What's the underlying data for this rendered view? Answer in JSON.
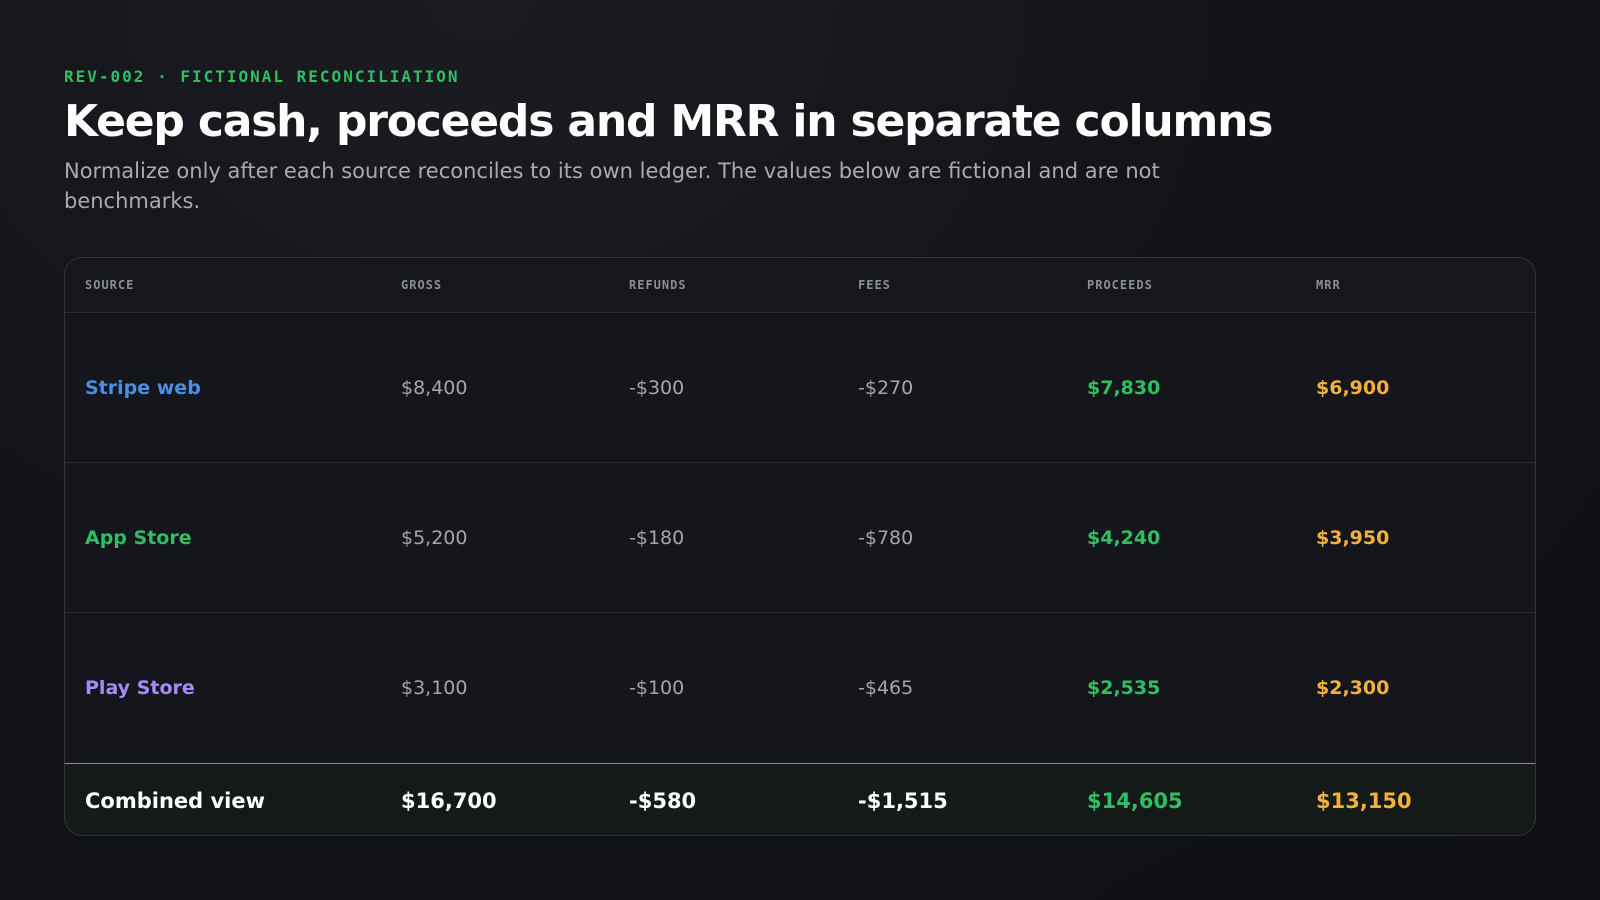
{
  "eyebrow": "REV-002 · FICTIONAL RECONCILIATION",
  "title": "Keep cash, proceeds and MRR in separate columns",
  "subtitle": "Normalize only after each source reconciles to its own ledger. The values below are fictional and are not benchmarks.",
  "colors": {
    "accent_green": "#2fbf63",
    "accent_amber": "#f2b13c",
    "stripe_blue": "#4a8fe6",
    "app_store_green": "#2fbf63",
    "play_store_purple": "#a78bfa"
  },
  "table": {
    "headers": [
      "SOURCE",
      "GROSS",
      "REFUNDS",
      "FEES",
      "PROCEEDS",
      "MRR"
    ],
    "rows": [
      {
        "source": "Stripe web",
        "source_color": "#4a8fe6",
        "gross": "$8,400",
        "refunds": "-$300",
        "fees": "-$270",
        "proceeds": "$7,830",
        "mrr": "$6,900"
      },
      {
        "source": "App Store",
        "source_color": "#2fbf63",
        "gross": "$5,200",
        "refunds": "-$180",
        "fees": "-$780",
        "proceeds": "$4,240",
        "mrr": "$3,950"
      },
      {
        "source": "Play Store",
        "source_color": "#a78bfa",
        "gross": "$3,100",
        "refunds": "-$100",
        "fees": "-$465",
        "proceeds": "$2,535",
        "mrr": "$2,300"
      }
    ],
    "total": {
      "source": "Combined view",
      "gross": "$16,700",
      "refunds": "-$580",
      "fees": "-$1,515",
      "proceeds": "$14,605",
      "mrr": "$13,150"
    }
  }
}
